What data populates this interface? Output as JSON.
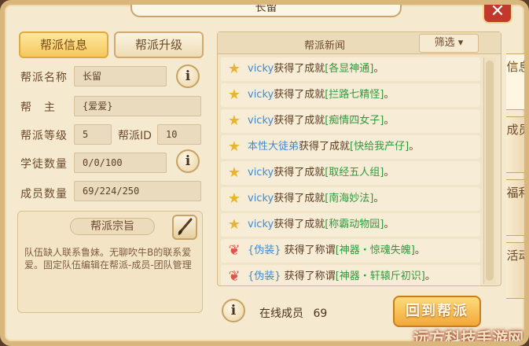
{
  "window": {
    "title": "长留",
    "close_label": "✕"
  },
  "tabs": {
    "info": "帮派信息",
    "upgrade": "帮派升级"
  },
  "fields": {
    "name_label": "帮派名称",
    "name_value": "长留",
    "leader_label": "帮　主",
    "leader_value": "{爱爱}",
    "level_label": "帮派等级",
    "level_value": "5",
    "id_label": "帮派ID",
    "id_value": "10",
    "apprentice_label": "学徒数量",
    "apprentice_value": "0/0/100",
    "members_label": "成员数量",
    "members_value": "69/224/250"
  },
  "purpose": {
    "title": "帮派宗旨",
    "text": "队伍缺人联系鲁妹。无聊吹牛B的联系爱爱。固定队伍编辑在帮派-成员-团队管理"
  },
  "news": {
    "title": "帮派新闻",
    "filter": "筛选 ▾",
    "items": [
      {
        "icon": "star",
        "who": "vicky",
        "verb": "获得了成就",
        "what": "[各显神通]",
        "end": "。"
      },
      {
        "icon": "star",
        "who": "vicky",
        "verb": "获得了成就",
        "what": "[拦路七精怪]",
        "end": "。"
      },
      {
        "icon": "star",
        "who": "vicky",
        "verb": "获得了成就",
        "what": "[痴情四女子]",
        "end": "。"
      },
      {
        "icon": "star",
        "who": "本性大徒弟",
        "verb": "获得了成就",
        "what": "[快给我产仔]",
        "end": "。"
      },
      {
        "icon": "star",
        "who": "vicky",
        "verb": "获得了成就",
        "what": "[取经五人组]",
        "end": "。"
      },
      {
        "icon": "star",
        "who": "vicky",
        "verb": "获得了成就",
        "what": "[南海妙法]",
        "end": "。"
      },
      {
        "icon": "star",
        "who": "vicky",
        "verb": "获得了成就",
        "what": "[称霸动物园]",
        "end": "。"
      },
      {
        "icon": "wing",
        "who": "{伪装}",
        "verb": " 获得了称谓",
        "what": "[神器・惊魂失魄]",
        "end": "。"
      },
      {
        "icon": "wing",
        "who": "{伪装}",
        "verb": " 获得了称谓",
        "what": "[神器・轩辕斤初识]",
        "end": "。"
      }
    ]
  },
  "online": {
    "label": "在线成员",
    "count": "69"
  },
  "return_button": "回到帮派",
  "side_tabs": [
    "信息",
    "成员",
    "福利",
    "活动"
  ],
  "watermark": "远方科技手游网",
  "icons": {
    "info": "i",
    "star": "★",
    "wing": "❦",
    "brush": "✎"
  }
}
